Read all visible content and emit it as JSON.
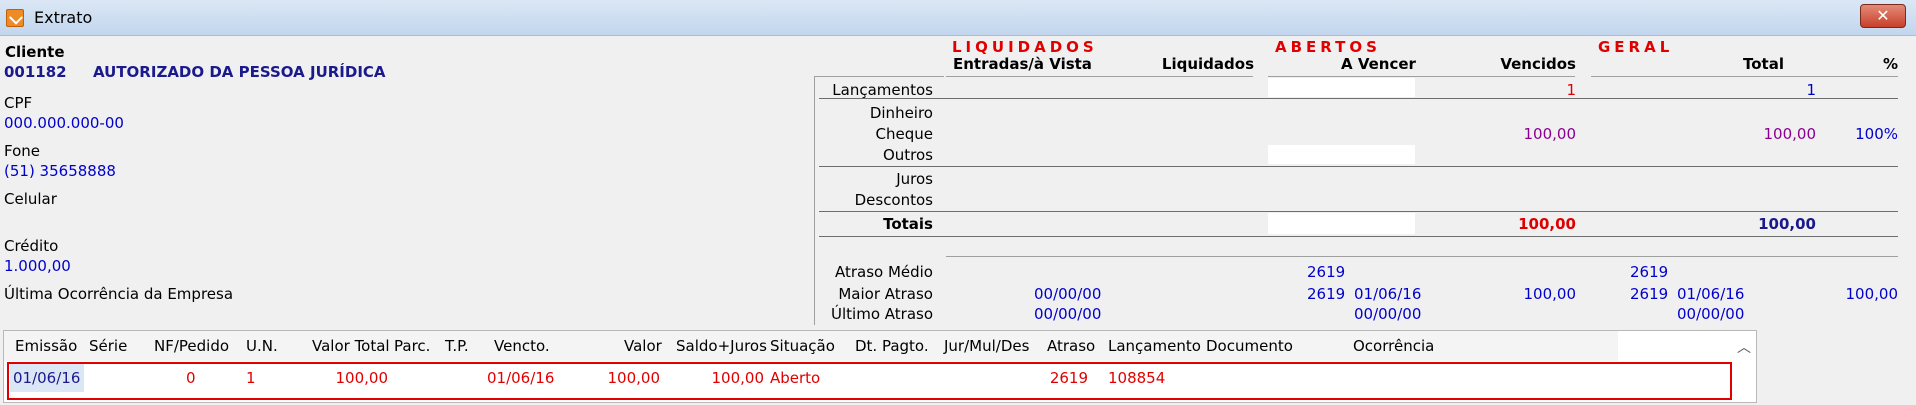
{
  "window": {
    "title": "Extrato",
    "close_label": "✕"
  },
  "client": {
    "label": "Cliente",
    "code": "001182",
    "name": "AUTORIZADO DA PESSOA JURÍDICA",
    "cpf_label": "CPF",
    "cpf": "000.000.000-00",
    "phone_label": "Fone",
    "phone": "(51) 35658888",
    "mobile_label": "Celular",
    "credit_label": "Crédito",
    "credit": "1.000,00",
    "last_event_label": "Última Ocorrência da Empresa"
  },
  "summary": {
    "sections": {
      "liquidados": "LIQUIDADOS",
      "abertos": "ABERTOS",
      "geral": "GERAL"
    },
    "col_headers": {
      "entradas": "Entradas/à Vista",
      "liquidados": "Liquidados",
      "a_vencer": "A Vencer",
      "vencidos": "Vencidos",
      "total": "Total",
      "pct": "%"
    },
    "rows": {
      "lancamentos": "Lançamentos",
      "dinheiro": "Dinheiro",
      "cheque": "Cheque",
      "outros": "Outros",
      "juros": "Juros",
      "descontos": "Descontos",
      "totais": "Totais",
      "atraso_medio": "Atraso Médio",
      "maior_atraso": "Maior Atraso",
      "ultimo_atraso": "Último Atraso"
    },
    "values": {
      "vencidos_lanc": "1",
      "total_lanc": "1",
      "vencidos_cheque": "100,00",
      "total_cheque": "100,00",
      "pct_cheque": "100%",
      "vencidos_totais": "100,00",
      "total_totais": "100,00",
      "liq_maior_atraso": "00/00/00",
      "liq_ultimo_atraso": "00/00/00",
      "ab_atraso_medio": "2619",
      "ab_maior_dias": "2619",
      "ab_maior_data": "01/06/16",
      "ab_maior_valor": "100,00",
      "ab_ultimo": "00/00/00",
      "ger_atraso_medio": "2619",
      "ger_maior_dias": "2619",
      "ger_maior_data": "01/06/16",
      "ger_maior_valor": "100,00",
      "ger_ultimo": "00/00/00"
    }
  },
  "grid": {
    "columns": [
      "Emissão",
      "Série",
      "NF/Pedido",
      "U.N.",
      "Valor Total",
      "Parc.",
      "T.P.",
      "Vencto.",
      "Valor",
      "Saldo+Juros",
      "Situação",
      "Dt. Pagto.",
      "Jur/Mul/Des",
      "Atraso",
      "Lançamento",
      "Documento",
      "Ocorrência"
    ],
    "rows": [
      {
        "emissao": "01/06/16",
        "serie": "",
        "nf_pedido": "0",
        "un": "1",
        "valor_total": "100,00",
        "parc": "",
        "tp": "",
        "vencto": "01/06/16",
        "valor": "100,00",
        "saldo_juros": "100,00",
        "situacao": "Aberto",
        "dt_pagto": "",
        "jur_mul_des": "",
        "atraso": "2619",
        "lancamento": "108854",
        "documento": "",
        "ocorrencia": ""
      }
    ]
  },
  "colors": {
    "accent_red": "#e00000",
    "blue": "#0000cc",
    "purple": "#8a0090"
  }
}
